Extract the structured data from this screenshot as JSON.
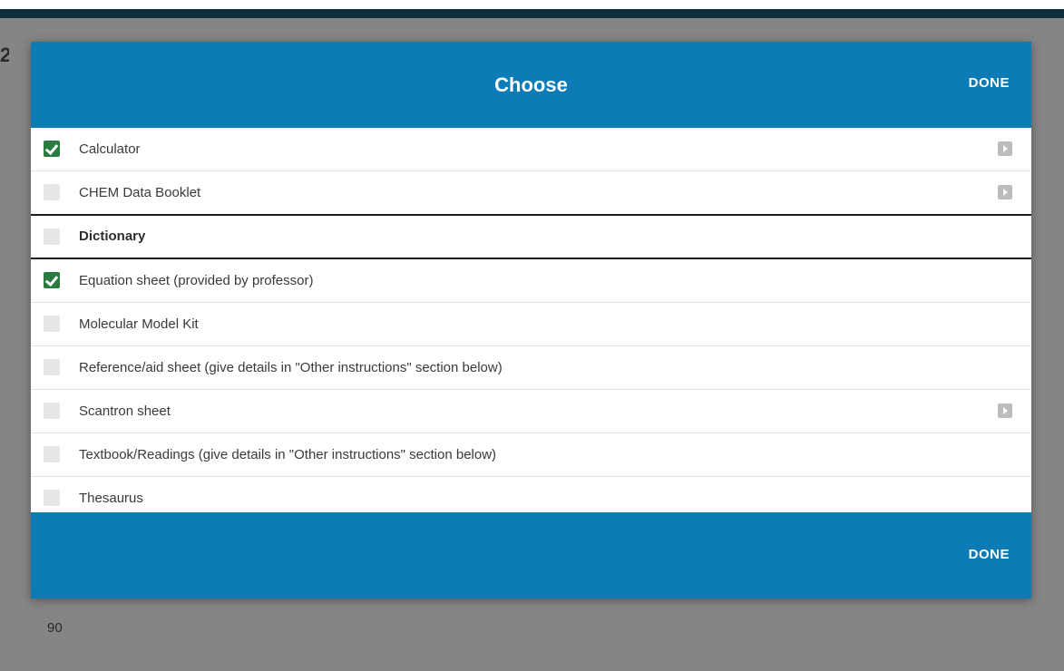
{
  "dialog": {
    "title": "Choose",
    "done_top_label": "DONE",
    "done_bottom_label": "DONE"
  },
  "items": [
    {
      "label": "Calculator",
      "checked": true,
      "has_arrow": true
    },
    {
      "label": "CHEM Data Booklet",
      "checked": false,
      "has_arrow": true
    },
    {
      "label": "Dictionary",
      "checked": false,
      "has_arrow": false,
      "highlighted": true
    },
    {
      "label": "Equation sheet (provided by professor)",
      "checked": true,
      "has_arrow": false
    },
    {
      "label": "Molecular Model Kit",
      "checked": false,
      "has_arrow": false
    },
    {
      "label": "Reference/aid sheet (give details in \"Other instructions\" section below)",
      "checked": false,
      "has_arrow": false
    },
    {
      "label": "Scantron sheet",
      "checked": false,
      "has_arrow": true
    },
    {
      "label": "Textbook/Readings (give details in \"Other instructions\" section below)",
      "checked": false,
      "has_arrow": false
    },
    {
      "label": "Thesaurus",
      "checked": false,
      "has_arrow": false
    }
  ],
  "background": {
    "number_text": "90"
  },
  "colors": {
    "header": "#0d7bb5",
    "checkbox_checked": "#2b7a3f",
    "overlay": "#858585"
  }
}
